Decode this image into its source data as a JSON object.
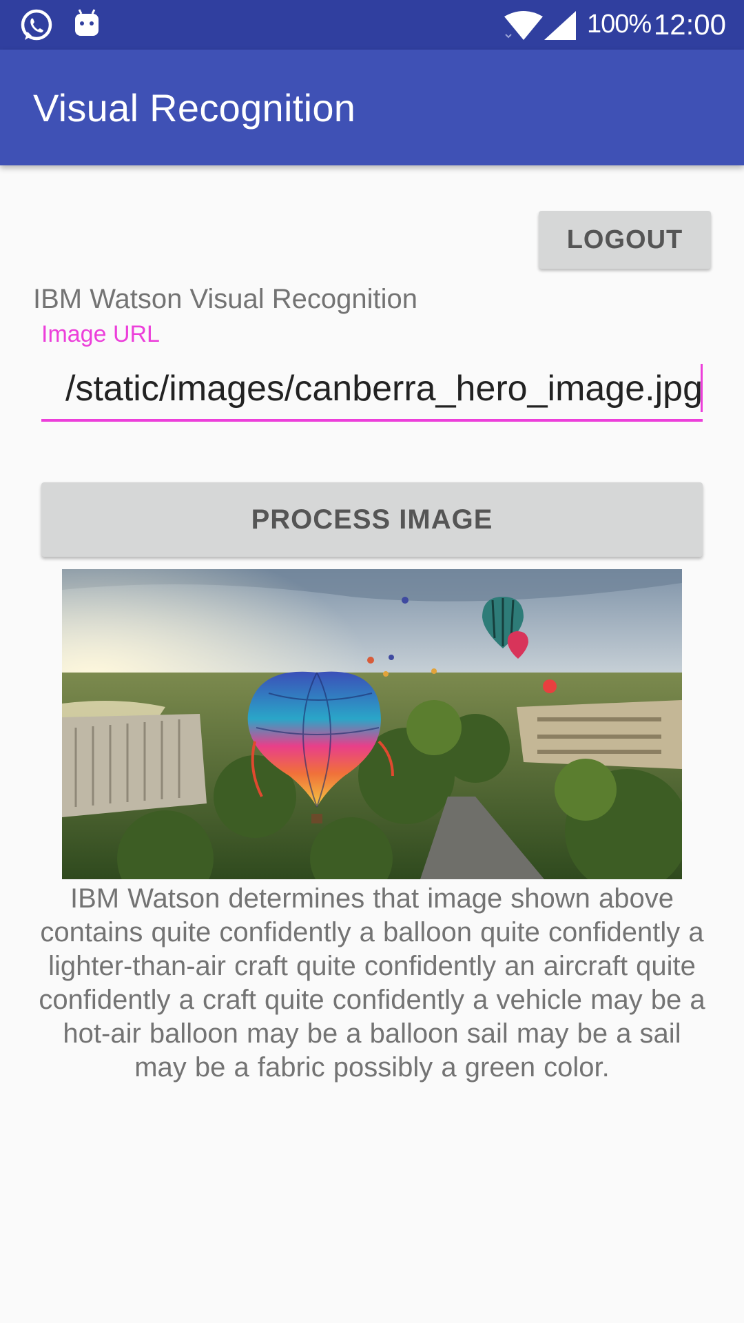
{
  "status_bar": {
    "icons": [
      "whatsapp-icon",
      "android-icon",
      "wifi-icon",
      "signal-icon"
    ],
    "battery": "100%",
    "time": "12:00"
  },
  "app_bar": {
    "title": "Visual Recognition"
  },
  "main": {
    "logout_label": "LOGOUT",
    "heading": "IBM Watson Visual Recognition",
    "url_field": {
      "label": "Image URL",
      "value": "/static/images/canberra_hero_image.jpg"
    },
    "process_label": "PROCESS IMAGE",
    "photo": {
      "subject": "hot-air balloons over Canberra"
    },
    "result": "IBM Watson determines that image shown above contains   quite confidently a balloon quite confidently a lighter-than-air craft quite confidently an aircraft quite confidently a craft quite confidently a vehicle may be a hot-air balloon may be a balloon sail may be a sail may be a fabric possibly a green color."
  },
  "colors": {
    "status_bar": "#303f9f",
    "app_bar": "#3f51b5",
    "accent": "#ec3fda",
    "button": "#d6d7d7",
    "background": "#fafafa"
  }
}
